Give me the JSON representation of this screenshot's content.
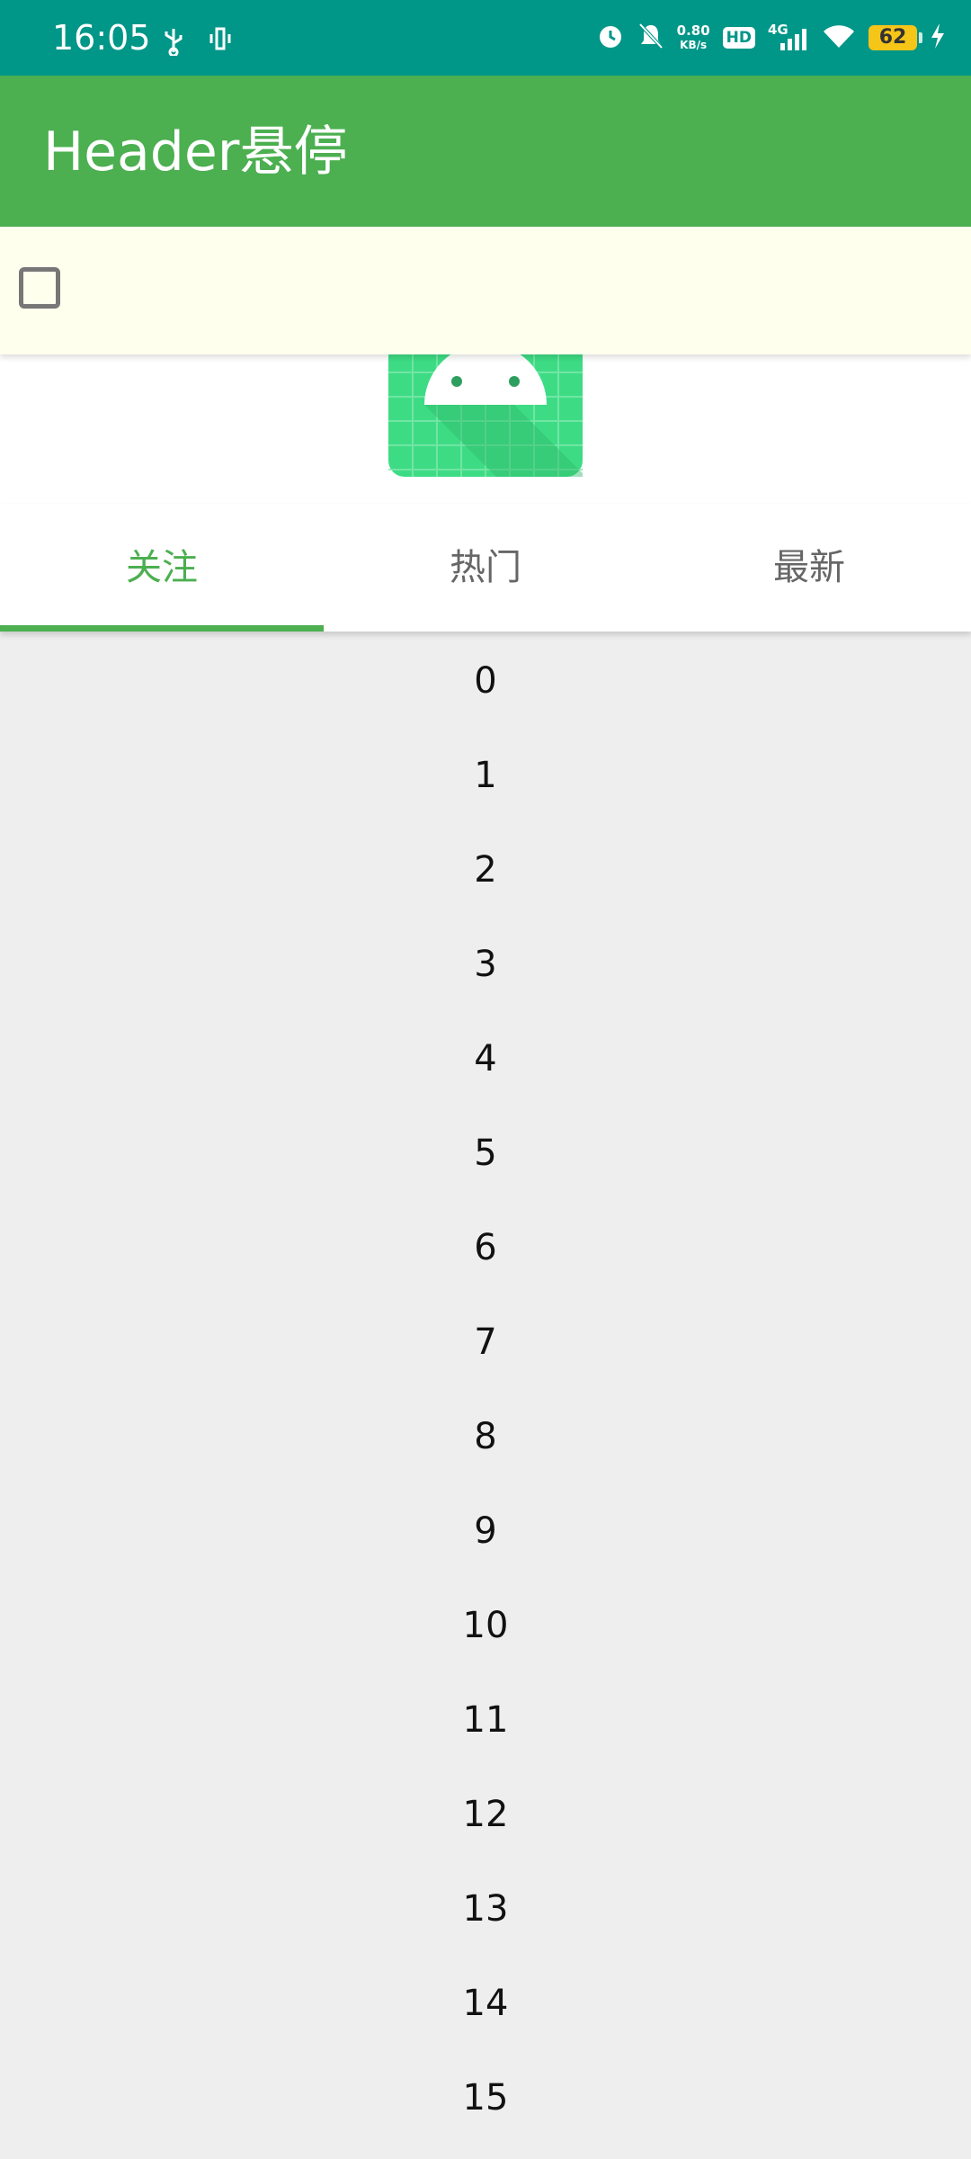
{
  "status_bar": {
    "time": "16:05",
    "net_speed_value": "0.80",
    "net_speed_unit": "KB/s",
    "hd_label": "HD",
    "network_type": "4G",
    "battery_level": "62",
    "icons": [
      "usb-icon",
      "vibrate-icon",
      "alarm-icon",
      "notifications-off-icon",
      "signal-icon",
      "wifi-icon",
      "charging-icon"
    ]
  },
  "app_bar": {
    "title": "Header悬停",
    "color": "#4caf50"
  },
  "header": {
    "checkbox_checked": false,
    "logo": "android-logo"
  },
  "tabs": [
    {
      "label": "关注",
      "selected": true
    },
    {
      "label": "热门",
      "selected": false
    },
    {
      "label": "最新",
      "selected": false
    }
  ],
  "list": {
    "items": [
      "0",
      "1",
      "2",
      "3",
      "4",
      "5",
      "6",
      "7",
      "8",
      "9",
      "10",
      "11",
      "12",
      "13",
      "14",
      "15"
    ]
  }
}
